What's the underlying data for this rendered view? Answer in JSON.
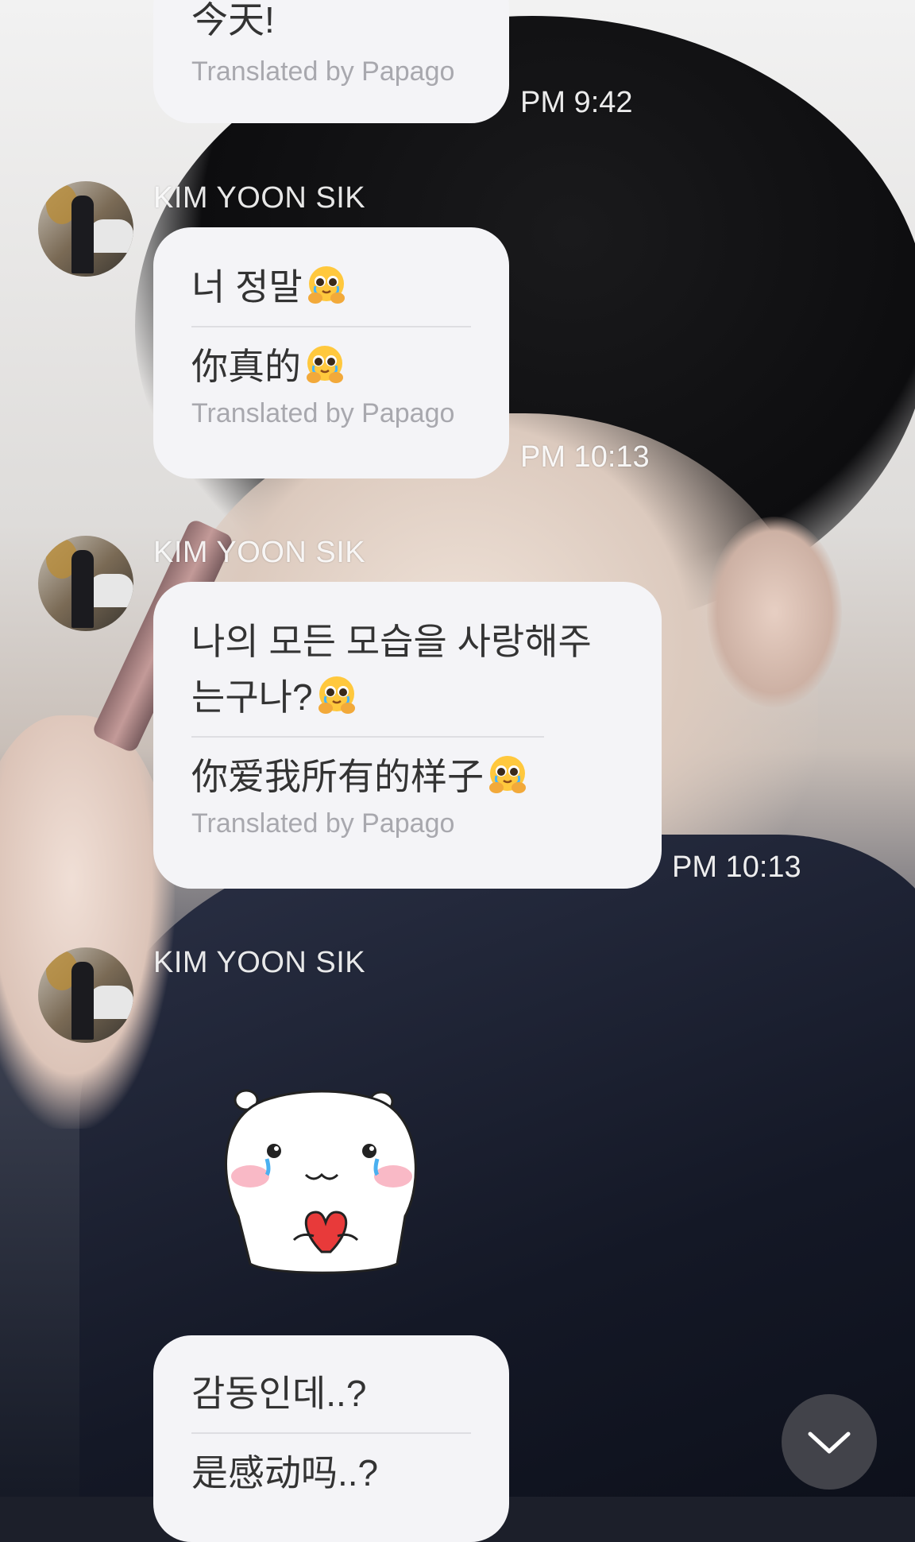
{
  "messages": [
    {
      "original": "今天!",
      "translation_credit": "Translated by Papago",
      "time": "PM 9:42"
    },
    {
      "sender": "KIM YOON SIK",
      "original": "너 정말",
      "translation": "你真的",
      "translation_credit": "Translated by Papago",
      "time": "PM 10:13"
    },
    {
      "sender": "KIM YOON SIK",
      "original": "나의 모든 모습을 사랑해주는구나?",
      "translation": "你爱我所有的样子",
      "translation_credit": "Translated by Papago",
      "time": "PM 10:13"
    },
    {
      "sender": "KIM YOON SIK",
      "sticker": "crying-hamster-holding-heart"
    },
    {
      "original": "감동인데..?",
      "translation": "是感动吗..?"
    }
  ],
  "icons": {
    "emoji": "pleading-face-hugging-emoji",
    "scroll_button": "chevron-down-icon"
  },
  "colors": {
    "bubble": "#f4f4f7",
    "text": "#333333",
    "credit": "#a8a8ae",
    "scroll_button": "#46484e"
  }
}
